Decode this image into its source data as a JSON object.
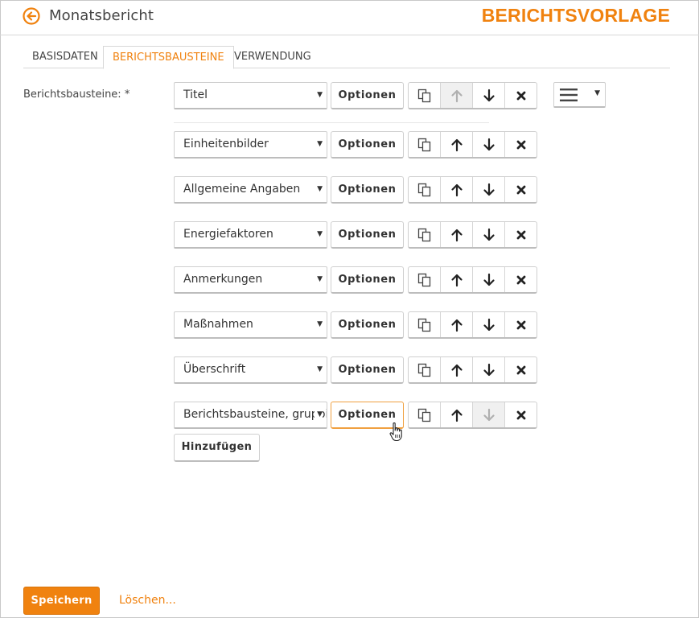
{
  "header": {
    "title": "Monatsbericht",
    "brand": "BERICHTSVORLAGE",
    "accent_color": "#f0820f",
    "back_icon": "arrow-left-circle-icon"
  },
  "tabs": [
    {
      "label": "BASISDATEN",
      "active": false
    },
    {
      "label": "BERICHTSBAUSTEINE",
      "active": true
    },
    {
      "label": "VERWENDUNG",
      "active": false
    }
  ],
  "form": {
    "field_label": "Berichtsbausteine: *",
    "rows": [
      {
        "select": "Titel",
        "options_label": "Optionen",
        "up_disabled": true,
        "down_disabled": false
      },
      {
        "select": "Einheitenbilder",
        "options_label": "Optionen",
        "up_disabled": false,
        "down_disabled": false
      },
      {
        "select": "Allgemeine Angaben",
        "options_label": "Optionen",
        "up_disabled": false,
        "down_disabled": false
      },
      {
        "select": "Energiefaktoren",
        "options_label": "Optionen",
        "up_disabled": false,
        "down_disabled": false
      },
      {
        "select": "Anmerkungen",
        "options_label": "Optionen",
        "up_disabled": false,
        "down_disabled": false
      },
      {
        "select": "Maßnahmen",
        "options_label": "Optionen",
        "up_disabled": false,
        "down_disabled": false
      },
      {
        "select": "Überschrift",
        "options_label": "Optionen",
        "up_disabled": false,
        "down_disabled": false
      },
      {
        "select": "Berichtsbausteine, gruppiert",
        "options_label": "Optionen",
        "up_disabled": false,
        "down_disabled": true
      }
    ],
    "add_label": "Hinzufügen",
    "menu_icon": "hamburger-menu-icon"
  },
  "footer": {
    "save_label": "Speichern",
    "delete_label": "Löschen..."
  }
}
